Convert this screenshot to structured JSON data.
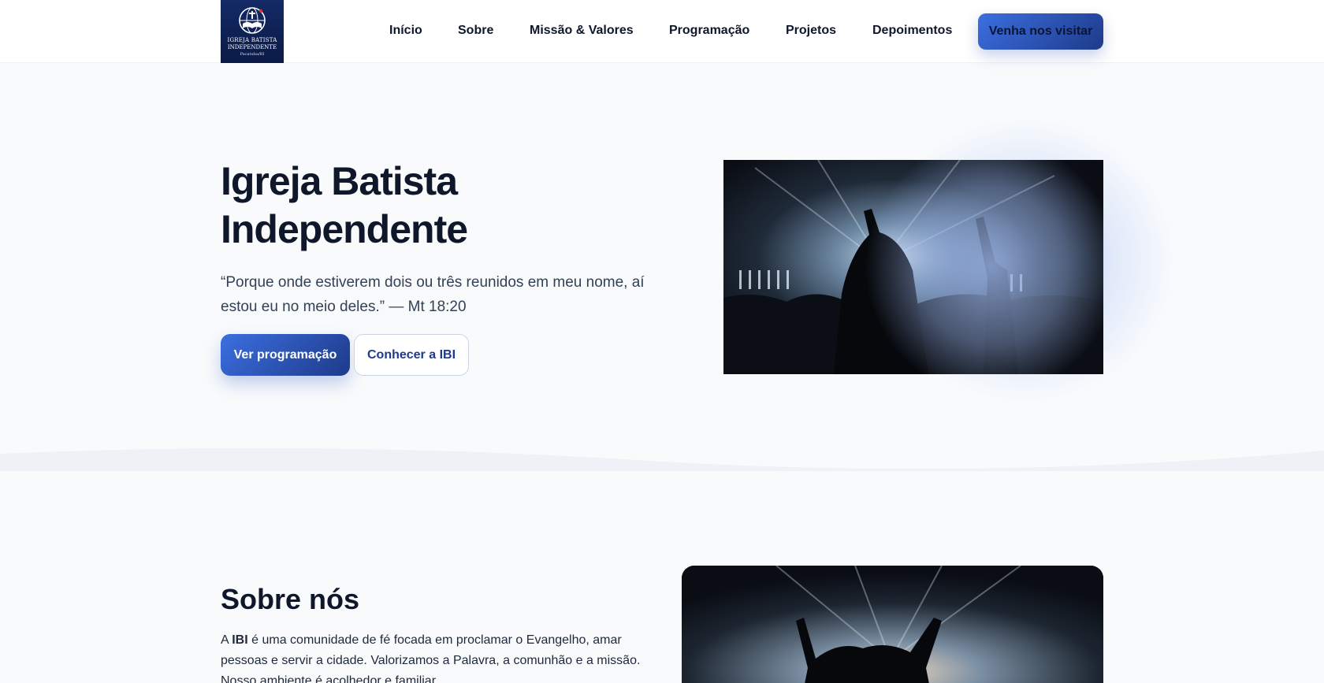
{
  "header": {
    "logo": {
      "line1": "IGREJA BATISTA",
      "line2": "INDEPENDENTE",
      "line3": "Pacatuba/RI"
    },
    "nav": [
      {
        "label": "Início"
      },
      {
        "label": "Sobre"
      },
      {
        "label": "Missão & Valores"
      },
      {
        "label": "Programação"
      },
      {
        "label": "Projetos"
      },
      {
        "label": "Depoimentos"
      }
    ],
    "cta_label": "Venha nos visitar"
  },
  "hero": {
    "title_line1": "Igreja Batista",
    "title_line2": "Independente",
    "quote": "“Porque onde estiverem dois ou três reunidos em meu nome, aí estou eu no meio deles.” — Mt 18:20",
    "primary_button": "Ver programação",
    "secondary_button": "Conhecer a IBI",
    "image": "worship-crowd-photo"
  },
  "about": {
    "title": "Sobre nós",
    "text_prefix": "A ",
    "text_bold": "IBI",
    "text_rest": " é uma comunidade de fé focada em proclamar o Evangelho, amar pessoas e servir a cidade. Valorizamos a Palavra, a comunhão e a missão. Nosso ambiente é acolhedor e familiar.",
    "image": "worship-crowd-photo"
  },
  "colors": {
    "accent": "#2f5fd6",
    "accent_dark": "#1e3a8a",
    "text": "#0f172a",
    "background": "#f8fafc"
  }
}
